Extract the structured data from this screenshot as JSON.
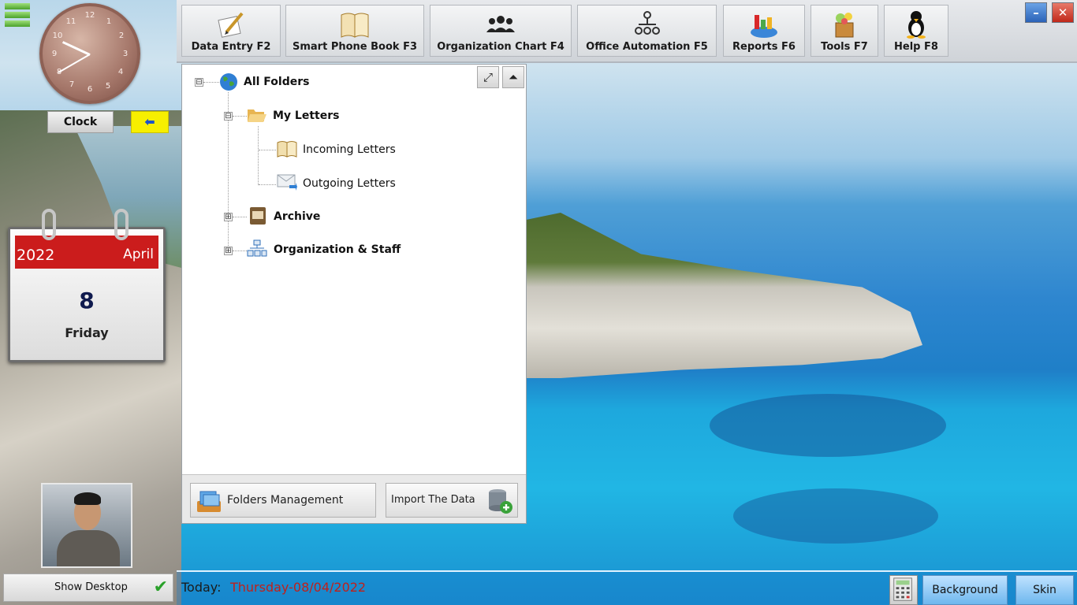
{
  "toolbar": {
    "items": [
      {
        "label": "Data Entry F2",
        "icon": "data-entry-icon"
      },
      {
        "label": "Smart Phone Book F3",
        "icon": "phone-book-icon"
      },
      {
        "label": "Organization Chart F4",
        "icon": "organization-chart-icon"
      },
      {
        "label": "Office Automation F5",
        "icon": "office-automation-icon"
      },
      {
        "label": "Reports F6",
        "icon": "reports-icon"
      },
      {
        "label": "Tools F7",
        "icon": "tools-icon"
      },
      {
        "label": "Help F8",
        "icon": "help-icon"
      }
    ]
  },
  "window": {
    "minimize_label": "–",
    "close_label": "✕"
  },
  "clock": {
    "label": "Clock",
    "numbers": [
      "12",
      "1",
      "2",
      "3",
      "4",
      "5",
      "6",
      "7",
      "8",
      "9",
      "10",
      "11"
    ],
    "back_glyph": "⬅"
  },
  "calendar": {
    "year": "2022",
    "month": "April",
    "day": "8",
    "weekday": "Friday"
  },
  "tree": {
    "root": "All Folders",
    "my_letters": "My Letters",
    "incoming": "Incoming Letters",
    "outgoing": "Outgoing Letters",
    "archive": "Archive",
    "organization": "Organization & Staff",
    "collapse_glyph": "⊟",
    "expand_glyph": "⊞"
  },
  "tree_footer": {
    "folders_management": "Folders Management",
    "import_data": "Import The Data"
  },
  "left": {
    "show_desktop": "Show Desktop",
    "check_glyph": "✔"
  },
  "status": {
    "today_label": "Today:",
    "today_value": "Thursday-08/04/2022",
    "background_label": "Background",
    "skin_label": "Skin"
  },
  "colors": {
    "calendar_header": "#cb1c1c",
    "today_text": "#c0201a",
    "back_button": "#f7ef00"
  }
}
